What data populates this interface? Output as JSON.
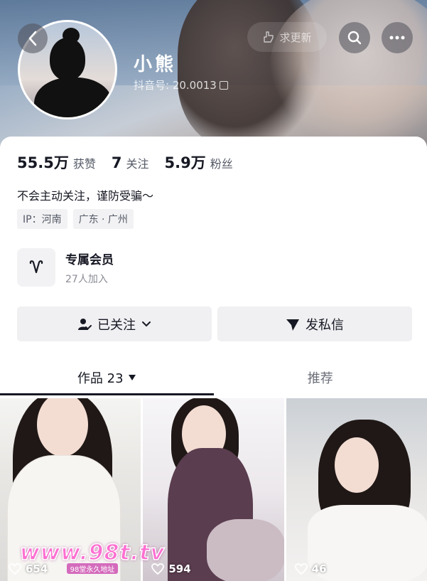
{
  "profile": {
    "username": "小熊",
    "douyin_id": "抖音号: 20.0013"
  },
  "header": {
    "request_update_label": "求更新"
  },
  "stats": [
    {
      "value": "55.5万",
      "label": "获赞"
    },
    {
      "value": "7",
      "label": "关注"
    },
    {
      "value": "5.9万",
      "label": "粉丝"
    }
  ],
  "bio": "不会主动关注，谨防受骗～",
  "tags": [
    "IP：河南",
    "广东 · 广州"
  ],
  "membership": {
    "title": "专属会员",
    "subtitle": "27人加入"
  },
  "actions": {
    "follow_label": "已关注",
    "message_label": "发私信"
  },
  "tabs": {
    "works_label": "作品 23",
    "recommend_label": "推荐"
  },
  "videos": [
    {
      "likes": "654"
    },
    {
      "likes": "594"
    },
    {
      "likes": "46"
    }
  ],
  "watermark": {
    "main": "www.98t.tv",
    "sub": "98堂永久地址"
  },
  "colors": {
    "text_primary": "#161823",
    "text_secondary": "#555a66",
    "button_bg": "#f0f0f2",
    "watermark_pink": "#ff6fd1"
  }
}
